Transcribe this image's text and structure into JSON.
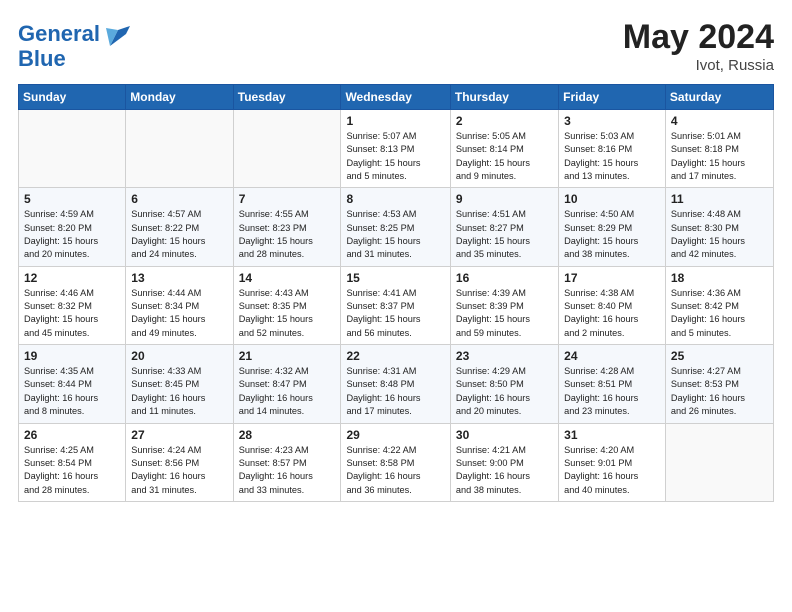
{
  "header": {
    "logo_line1": "General",
    "logo_line2": "Blue",
    "month": "May 2024",
    "location": "Ivot, Russia"
  },
  "weekdays": [
    "Sunday",
    "Monday",
    "Tuesday",
    "Wednesday",
    "Thursday",
    "Friday",
    "Saturday"
  ],
  "weeks": [
    [
      {
        "day": "",
        "content": ""
      },
      {
        "day": "",
        "content": ""
      },
      {
        "day": "",
        "content": ""
      },
      {
        "day": "1",
        "content": "Sunrise: 5:07 AM\nSunset: 8:13 PM\nDaylight: 15 hours\nand 5 minutes."
      },
      {
        "day": "2",
        "content": "Sunrise: 5:05 AM\nSunset: 8:14 PM\nDaylight: 15 hours\nand 9 minutes."
      },
      {
        "day": "3",
        "content": "Sunrise: 5:03 AM\nSunset: 8:16 PM\nDaylight: 15 hours\nand 13 minutes."
      },
      {
        "day": "4",
        "content": "Sunrise: 5:01 AM\nSunset: 8:18 PM\nDaylight: 15 hours\nand 17 minutes."
      }
    ],
    [
      {
        "day": "5",
        "content": "Sunrise: 4:59 AM\nSunset: 8:20 PM\nDaylight: 15 hours\nand 20 minutes."
      },
      {
        "day": "6",
        "content": "Sunrise: 4:57 AM\nSunset: 8:22 PM\nDaylight: 15 hours\nand 24 minutes."
      },
      {
        "day": "7",
        "content": "Sunrise: 4:55 AM\nSunset: 8:23 PM\nDaylight: 15 hours\nand 28 minutes."
      },
      {
        "day": "8",
        "content": "Sunrise: 4:53 AM\nSunset: 8:25 PM\nDaylight: 15 hours\nand 31 minutes."
      },
      {
        "day": "9",
        "content": "Sunrise: 4:51 AM\nSunset: 8:27 PM\nDaylight: 15 hours\nand 35 minutes."
      },
      {
        "day": "10",
        "content": "Sunrise: 4:50 AM\nSunset: 8:29 PM\nDaylight: 15 hours\nand 38 minutes."
      },
      {
        "day": "11",
        "content": "Sunrise: 4:48 AM\nSunset: 8:30 PM\nDaylight: 15 hours\nand 42 minutes."
      }
    ],
    [
      {
        "day": "12",
        "content": "Sunrise: 4:46 AM\nSunset: 8:32 PM\nDaylight: 15 hours\nand 45 minutes."
      },
      {
        "day": "13",
        "content": "Sunrise: 4:44 AM\nSunset: 8:34 PM\nDaylight: 15 hours\nand 49 minutes."
      },
      {
        "day": "14",
        "content": "Sunrise: 4:43 AM\nSunset: 8:35 PM\nDaylight: 15 hours\nand 52 minutes."
      },
      {
        "day": "15",
        "content": "Sunrise: 4:41 AM\nSunset: 8:37 PM\nDaylight: 15 hours\nand 56 minutes."
      },
      {
        "day": "16",
        "content": "Sunrise: 4:39 AM\nSunset: 8:39 PM\nDaylight: 15 hours\nand 59 minutes."
      },
      {
        "day": "17",
        "content": "Sunrise: 4:38 AM\nSunset: 8:40 PM\nDaylight: 16 hours\nand 2 minutes."
      },
      {
        "day": "18",
        "content": "Sunrise: 4:36 AM\nSunset: 8:42 PM\nDaylight: 16 hours\nand 5 minutes."
      }
    ],
    [
      {
        "day": "19",
        "content": "Sunrise: 4:35 AM\nSunset: 8:44 PM\nDaylight: 16 hours\nand 8 minutes."
      },
      {
        "day": "20",
        "content": "Sunrise: 4:33 AM\nSunset: 8:45 PM\nDaylight: 16 hours\nand 11 minutes."
      },
      {
        "day": "21",
        "content": "Sunrise: 4:32 AM\nSunset: 8:47 PM\nDaylight: 16 hours\nand 14 minutes."
      },
      {
        "day": "22",
        "content": "Sunrise: 4:31 AM\nSunset: 8:48 PM\nDaylight: 16 hours\nand 17 minutes."
      },
      {
        "day": "23",
        "content": "Sunrise: 4:29 AM\nSunset: 8:50 PM\nDaylight: 16 hours\nand 20 minutes."
      },
      {
        "day": "24",
        "content": "Sunrise: 4:28 AM\nSunset: 8:51 PM\nDaylight: 16 hours\nand 23 minutes."
      },
      {
        "day": "25",
        "content": "Sunrise: 4:27 AM\nSunset: 8:53 PM\nDaylight: 16 hours\nand 26 minutes."
      }
    ],
    [
      {
        "day": "26",
        "content": "Sunrise: 4:25 AM\nSunset: 8:54 PM\nDaylight: 16 hours\nand 28 minutes."
      },
      {
        "day": "27",
        "content": "Sunrise: 4:24 AM\nSunset: 8:56 PM\nDaylight: 16 hours\nand 31 minutes."
      },
      {
        "day": "28",
        "content": "Sunrise: 4:23 AM\nSunset: 8:57 PM\nDaylight: 16 hours\nand 33 minutes."
      },
      {
        "day": "29",
        "content": "Sunrise: 4:22 AM\nSunset: 8:58 PM\nDaylight: 16 hours\nand 36 minutes."
      },
      {
        "day": "30",
        "content": "Sunrise: 4:21 AM\nSunset: 9:00 PM\nDaylight: 16 hours\nand 38 minutes."
      },
      {
        "day": "31",
        "content": "Sunrise: 4:20 AM\nSunset: 9:01 PM\nDaylight: 16 hours\nand 40 minutes."
      },
      {
        "day": "",
        "content": ""
      }
    ]
  ]
}
